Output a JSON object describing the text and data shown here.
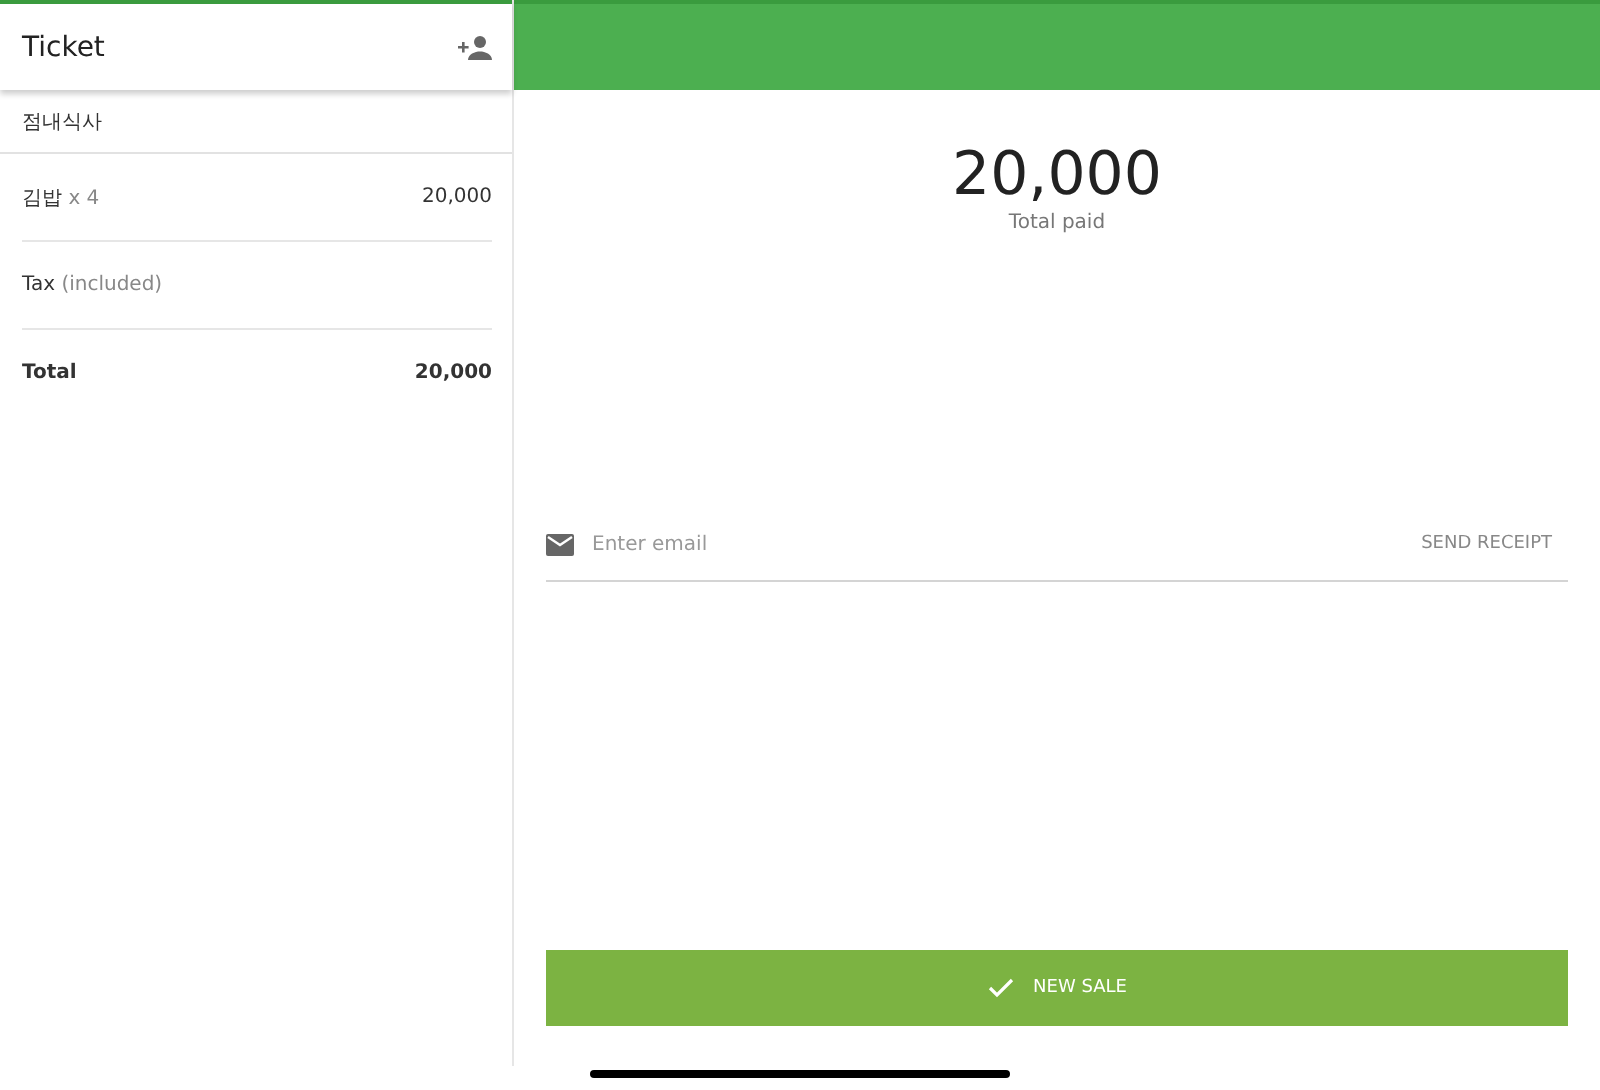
{
  "ticket": {
    "title": "Ticket",
    "customer": "점내식사",
    "lines": [
      {
        "kind": "item",
        "label": "김밥",
        "note": "x 4",
        "amount": "20,000"
      },
      {
        "kind": "tax",
        "label": "Tax",
        "note": "(included)"
      },
      {
        "kind": "total",
        "label": "Total",
        "amount": "20,000"
      }
    ]
  },
  "payment": {
    "amount": "20,000",
    "caption": "Total paid",
    "email": {
      "placeholder": "Enter email"
    },
    "send_button": "SEND RECEIPT",
    "new_sale_button": "NEW SALE"
  }
}
